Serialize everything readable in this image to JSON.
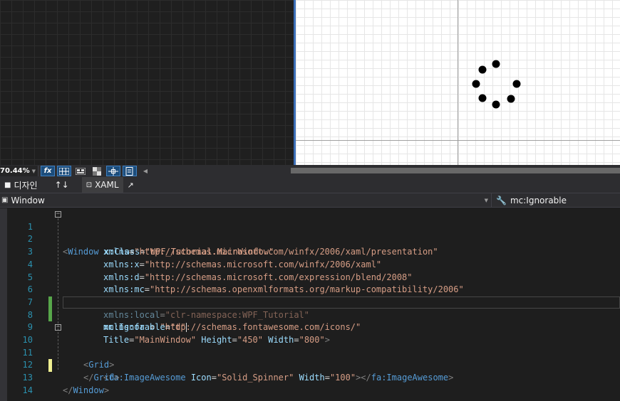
{
  "toolbar": {
    "zoom": "70.44%",
    "fx_label": "fx"
  },
  "view_tabs": {
    "design": "디자인",
    "swap": "↑↓",
    "xaml": "XAML"
  },
  "nav": {
    "element": "Window",
    "member": "mc:Ignorable"
  },
  "colors": {
    "editor_bg": "#1e1e1e",
    "line_number": "#2b91af",
    "element": "#569cd6",
    "attribute": "#9cdcfe",
    "string": "#d69d85",
    "changed_saved": "#57a64a",
    "changed_unsaved": "#efef91"
  },
  "code": {
    "line_numbers": [
      "1",
      "2",
      "3",
      "4",
      "5",
      "6",
      "7",
      "8",
      "9",
      "10",
      "11",
      "12",
      "13",
      "14"
    ],
    "l1": {
      "open": "<",
      "el": "Window",
      "at": " x:Class",
      "eq": "=",
      "val": "\"WPF_Tutorial.MainWindow\""
    },
    "l2": {
      "at": "xmlns",
      "eq": "=",
      "val": "\"http://schemas.microsoft.com/winfx/2006/xaml/presentation\""
    },
    "l3": {
      "at": "xmlns:x",
      "eq": "=",
      "val": "\"http://schemas.microsoft.com/winfx/2006/xaml\""
    },
    "l4": {
      "at": "xmlns:d",
      "eq": "=",
      "val": "\"http://schemas.microsoft.com/expression/blend/2008\""
    },
    "l5": {
      "at": "xmlns:mc",
      "eq": "=",
      "val": "\"http://schemas.openxmlformats.org/markup-compatibility/2006\""
    },
    "l6": {
      "at": "xmlns:local",
      "eq": "=",
      "val": "\"clr-namespace:WPF_Tutorial\""
    },
    "l7": {
      "at": "xmlns:fa ",
      "eq": "=",
      "val": " \"http://schemas.fontawesome.com/icons/\""
    },
    "l8": {
      "at": "mc:Ignorable",
      "eq": "=",
      "val": "\"d\""
    },
    "l9": {
      "at1": "Title",
      "val1": "\"MainWindow\"",
      "at2": " Height",
      "val2": "\"450\"",
      "at3": " Width",
      "val3": "\"800\"",
      "close": ">"
    },
    "l10": {
      "open": "<",
      "el": "Grid",
      "close": ">"
    },
    "l11": {
      "open": "<",
      "el": "fa:ImageAwesome",
      "at1": " Icon",
      "val1": "\"Solid_Spinner\"",
      "at2": " Width",
      "val2": "\"100\"",
      "mid": "></",
      "el2": "fa:ImageAwesome",
      "close": ">"
    },
    "l12": {
      "open": "</",
      "el": "Grid",
      "close": ">"
    },
    "l13": {
      "open": "</",
      "el": "Window",
      "close": ">"
    }
  }
}
